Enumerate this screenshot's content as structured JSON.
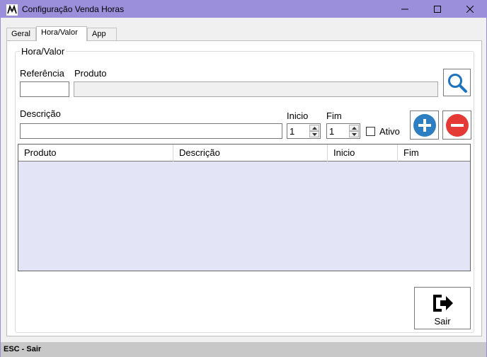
{
  "window": {
    "title": "Configuração Venda Horas"
  },
  "tabs": [
    {
      "label": "Geral"
    },
    {
      "label": "Hora/Valor"
    },
    {
      "label": "App"
    }
  ],
  "group": {
    "title": "Hora/Valor"
  },
  "form": {
    "referencia_label": "Referência",
    "produto_label": "Produto",
    "referencia_value": "",
    "produto_value": "",
    "descricao_label": "Descrição",
    "descricao_value": "",
    "inicio_label": "Inicio",
    "inicio_value": "1",
    "fim_label": "Fim",
    "fim_value": "1",
    "ativo_label": "Ativo"
  },
  "grid": {
    "columns": [
      "Produto",
      "Descrição",
      "Inicio",
      "Fim"
    ],
    "rows": []
  },
  "actions": {
    "sair_label": "Sair"
  },
  "statusbar": {
    "text": "ESC - Sair"
  },
  "colors": {
    "titlebar": "#9b8fdc",
    "grid_background": "#e4e4f7",
    "search_icon": "#1e73be",
    "add_icon": "#2d7fc1",
    "remove_icon": "#e53935"
  }
}
